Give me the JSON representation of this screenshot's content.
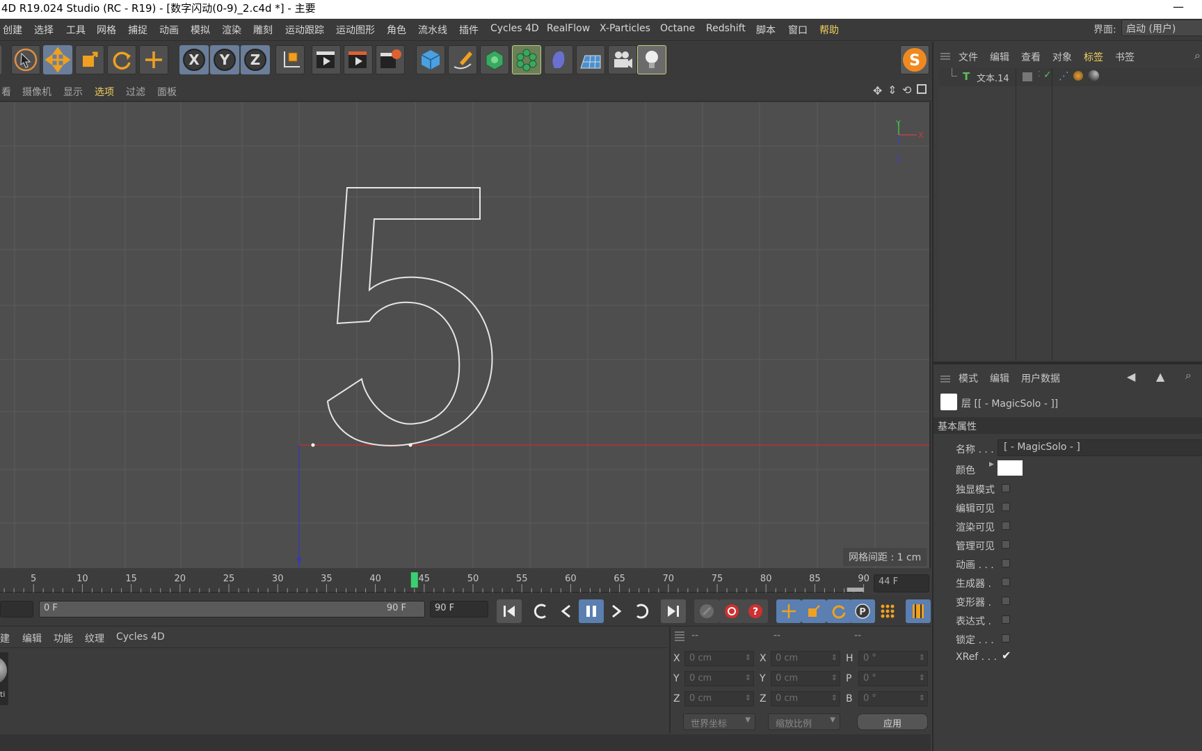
{
  "window": {
    "title": "4D R19.024 Studio (RC - R19) - [数字闪动(0-9)_2.c4d *] - 主要",
    "minimize": "—"
  },
  "menu": {
    "items": [
      "创建",
      "选择",
      "工具",
      "网格",
      "捕捉",
      "动画",
      "模拟",
      "渲染",
      "雕刻",
      "运动跟踪",
      "运动图形",
      "角色",
      "流水线",
      "插件",
      "Cycles 4D",
      "RealFlow",
      "X-Particles",
      "Octane",
      "Redshift",
      "脚本",
      "窗口",
      "帮助"
    ],
    "interface_label": "界面:",
    "interface_value": "启动 (用户)"
  },
  "toolbar": {
    "icons": [
      "cursor-tool-icon",
      "move-tool-icon",
      "scale-tool-icon",
      "rotate-tool-icon",
      "live-select-icon",
      "x-axis-icon",
      "y-axis-icon",
      "z-axis-icon",
      "coordinate-system-icon",
      "render-view-icon",
      "render-picture-viewer-icon",
      "render-settings-icon",
      "cube-primitive-icon",
      "pen-spline-icon",
      "subdivision-nurbs-icon",
      "cloner-mograph-icon",
      "deformer-icon",
      "floor-environment-icon",
      "camera-icon",
      "light-icon"
    ],
    "plugin_badge": "S"
  },
  "viewport": {
    "menu": [
      "看",
      "摄像机",
      "显示",
      "选项",
      "过滤",
      "面板"
    ],
    "active_menu": "选项",
    "grid_spacing": "网格间距 : 1 cm",
    "axis_y": "Y",
    "axis_x": "X",
    "axis_z": "Z",
    "colors": {
      "background": "#4e4e4e",
      "grid": "#5a5a5a",
      "spline": "#e0e0e0",
      "x_axis": "#c03030",
      "z_axis": "#3030c0"
    }
  },
  "timeline": {
    "ticks": [
      "5",
      "10",
      "15",
      "20",
      "25",
      "30",
      "35",
      "40",
      "45",
      "50",
      "55",
      "60",
      "65",
      "70",
      "75",
      "80",
      "85",
      "90"
    ],
    "current_frame": 44,
    "current_frame_label": "44 F",
    "range_start": "0 F",
    "range_end": "90 F",
    "end_frame": "90 F"
  },
  "materials": {
    "menu": [
      "建",
      "编辑",
      "功能",
      "纹理",
      "Cycles 4D"
    ],
    "thumb_label": "ti"
  },
  "coordinates": {
    "header": [
      "--",
      "--",
      "--"
    ],
    "rows": [
      {
        "label1": "X",
        "value1": "0 cm",
        "label2": "X",
        "value2": "0 cm",
        "label3": "H",
        "value3": "0 °"
      },
      {
        "label1": "Y",
        "value1": "0 cm",
        "label2": "Y",
        "value2": "0 cm",
        "label3": "P",
        "value3": "0 °"
      },
      {
        "label1": "Z",
        "value1": "0 cm",
        "label2": "Z",
        "value2": "0 cm",
        "label3": "B",
        "value3": "0 °"
      }
    ],
    "world_dropdown": "世界坐标",
    "scale_dropdown": "缩放比例",
    "apply": "应用"
  },
  "objects": {
    "menu": [
      "文件",
      "编辑",
      "查看",
      "对象",
      "标签",
      "书签"
    ],
    "active_menu": "标签",
    "item_name": "文本.14",
    "item_icon": "T"
  },
  "attributes": {
    "menu": [
      "模式",
      "编辑",
      "用户数据"
    ],
    "layer_title": "层 [[ - MagicSolo - ]]",
    "section": "基本属性",
    "name_label": "名称 . . .",
    "name_value": "[ - MagicSolo - ]",
    "color_label": "颜色",
    "props": [
      {
        "label": "独显模式",
        "checked": false
      },
      {
        "label": "编辑可见",
        "checked": false
      },
      {
        "label": "渲染可见",
        "checked": false
      },
      {
        "label": "管理可见",
        "checked": false
      },
      {
        "label": "动画 . . .",
        "checked": false
      },
      {
        "label": "生成器 .",
        "checked": false
      },
      {
        "label": "变形器 .",
        "checked": false
      },
      {
        "label": "表达式 .",
        "checked": false
      },
      {
        "label": "锁定 . . .",
        "checked": false
      },
      {
        "label": "XRef . . .",
        "checked": true
      }
    ]
  }
}
